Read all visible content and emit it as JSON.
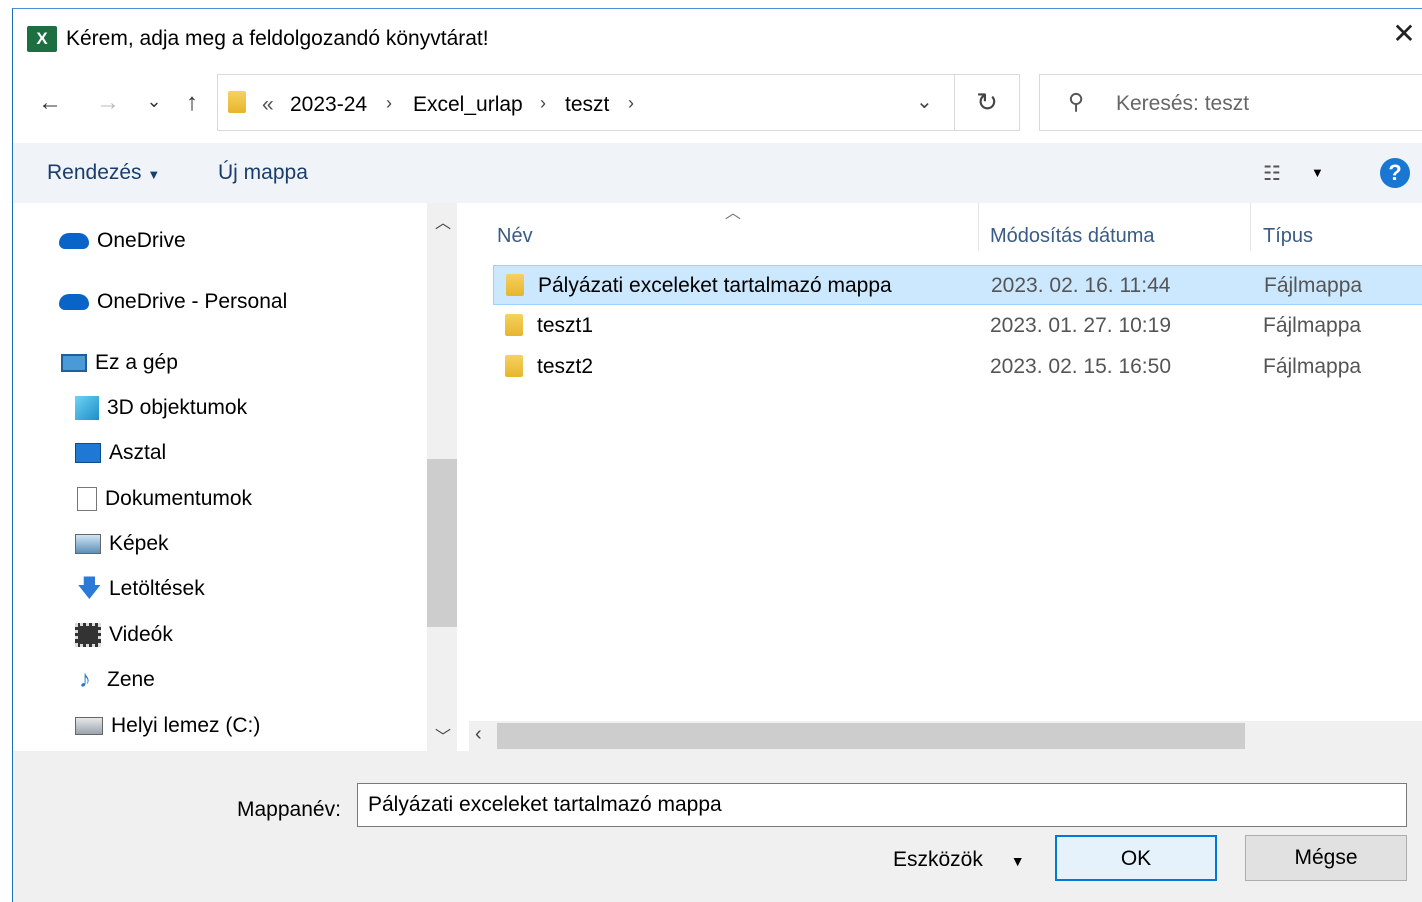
{
  "window": {
    "title": "Kérem, adja meg a feldolgozandó könyvtárat!",
    "app_icon_text": "X",
    "close": "✕"
  },
  "address": {
    "overflow": "«",
    "segments": [
      "2023-24",
      "Excel_urlap",
      "teszt"
    ],
    "search_placeholder": "Keresés: teszt"
  },
  "toolbar": {
    "organize": "Rendezés",
    "new_folder": "Új mappa",
    "help": "?"
  },
  "nav": {
    "items": [
      {
        "label": "OneDrive",
        "icon": "cloud-icon",
        "indent": 0
      },
      {
        "label": "OneDrive - Personal",
        "icon": "cloud-icon",
        "indent": 0
      },
      {
        "label": "Ez a gép",
        "icon": "computer-icon",
        "indent": 0
      },
      {
        "label": "3D objektumok",
        "icon": "cube-icon",
        "indent": 1
      },
      {
        "label": "Asztal",
        "icon": "desktop-icon",
        "indent": 1
      },
      {
        "label": "Dokumentumok",
        "icon": "document-icon",
        "indent": 1
      },
      {
        "label": "Képek",
        "icon": "picture-icon",
        "indent": 1
      },
      {
        "label": "Letöltések",
        "icon": "download-icon",
        "indent": 1
      },
      {
        "label": "Videók",
        "icon": "video-icon",
        "indent": 1
      },
      {
        "label": "Zene",
        "icon": "music-icon",
        "indent": 1
      },
      {
        "label": "Helyi lemez (C:)",
        "icon": "drive-icon",
        "indent": 1
      }
    ]
  },
  "columns": {
    "name": "Név",
    "modified": "Módosítás dátuma",
    "type": "Típus"
  },
  "files": [
    {
      "name": "Pályázati exceleket tartalmazó mappa",
      "modified": "2023. 02. 16. 11:44",
      "type": "Fájlmappa",
      "selected": true
    },
    {
      "name": "teszt1",
      "modified": "2023. 01. 27. 10:19",
      "type": "Fájlmappa",
      "selected": false
    },
    {
      "name": "teszt2",
      "modified": "2023. 02. 15. 16:50",
      "type": "Fájlmappa",
      "selected": false
    }
  ],
  "footer": {
    "folder_label": "Mappanév:",
    "folder_value": "Pályázati exceleket tartalmazó mappa",
    "tools": "Eszközök",
    "ok": "OK",
    "cancel": "Mégse"
  },
  "colors": {
    "accent": "#0078d7",
    "selection": "#cce8ff",
    "excel_green": "#1d6f42"
  }
}
